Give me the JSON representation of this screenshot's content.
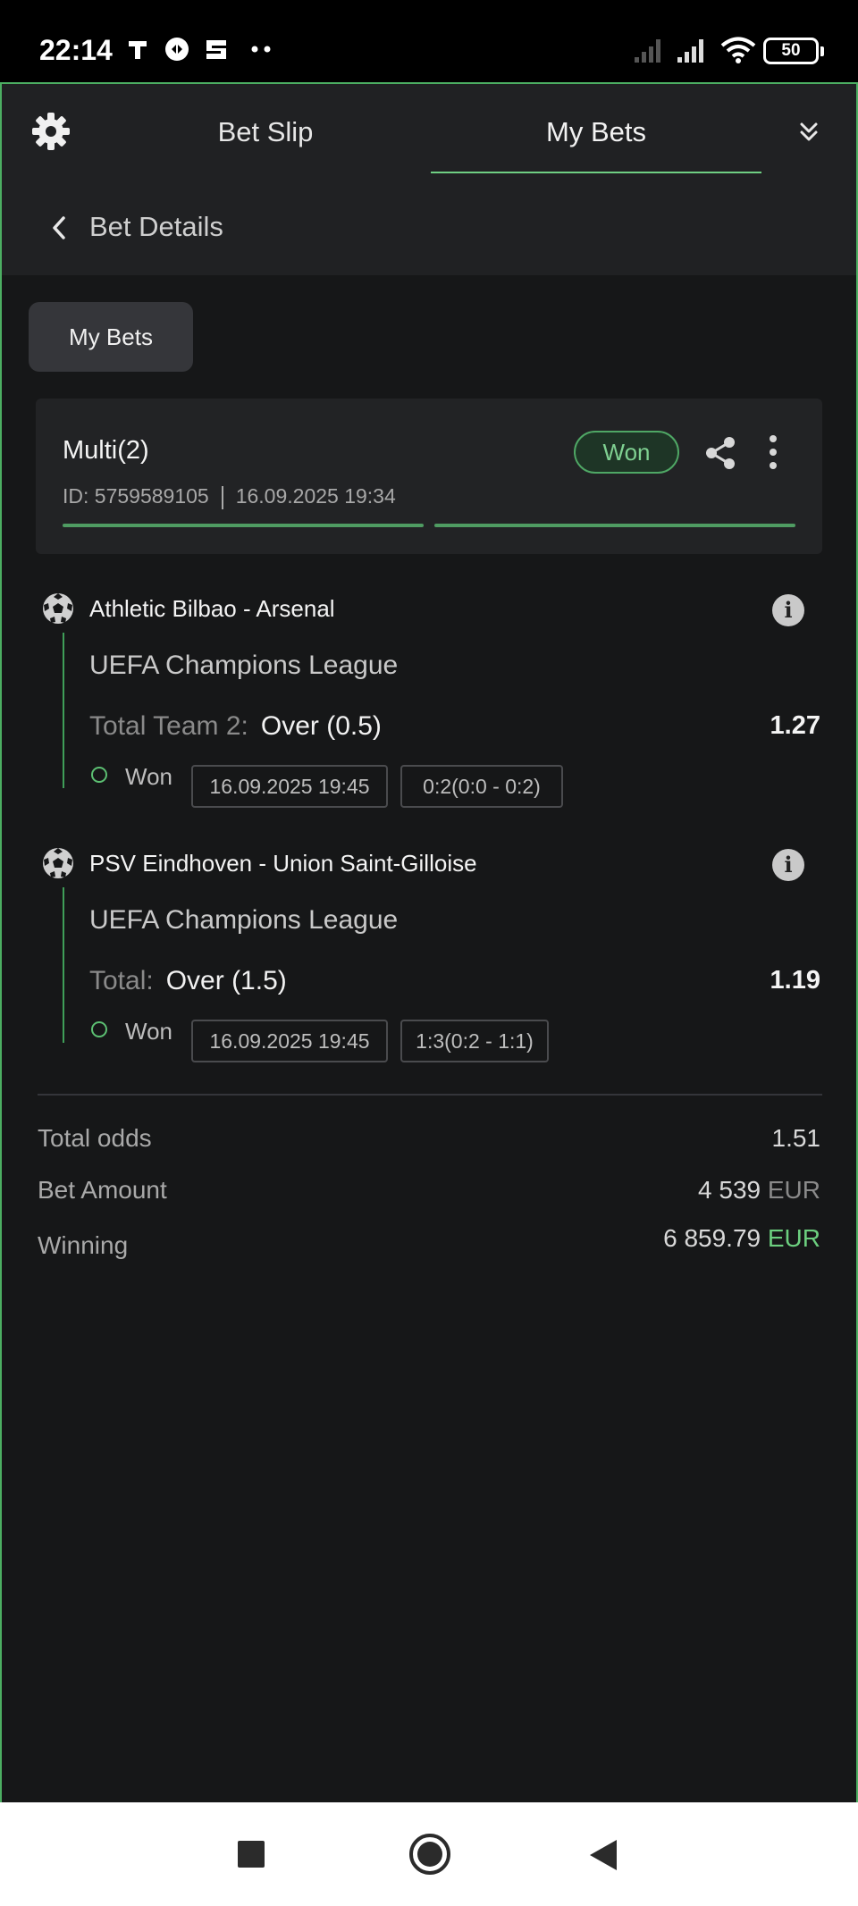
{
  "status_bar": {
    "time": "22:14",
    "battery": "50"
  },
  "tabs": {
    "bet_slip": "Bet Slip",
    "my_bets": "My Bets"
  },
  "header": {
    "title": "Bet Details"
  },
  "my_bets_button": "My Bets",
  "bet": {
    "title": "Multi(2)",
    "id_label": "ID: 5759589105",
    "placed_at": "16.09.2025 19:34",
    "status": "Won",
    "accent_color": "#4fa765"
  },
  "events": [
    {
      "teams": "Athletic Bilbao - Arsenal",
      "league": "UEFA Champions League",
      "market": "Total Team 2:",
      "selection": "Over (0.5)",
      "odds": "1.27",
      "status": "Won",
      "date": "16.09.2025 19:45",
      "score": "0:2(0:0 - 0:2)"
    },
    {
      "teams": "PSV Eindhoven - Union Saint-Gilloise",
      "league": "UEFA Champions League",
      "market": "Total:",
      "selection": "Over (1.5)",
      "odds": "1.19",
      "status": "Won",
      "date": "16.09.2025 19:45",
      "score": "1:3(0:2 - 1:1)"
    }
  ],
  "summary": {
    "total_odds_label": "Total odds",
    "total_odds_value": "1.51",
    "bet_amount_label": "Bet Amount",
    "bet_amount_value": "4 539",
    "bet_amount_currency": "EUR",
    "winning_label": "Winning",
    "winning_value": "6 859.79",
    "winning_currency": "EUR"
  },
  "icons": {
    "settings": "gear-icon",
    "collapse": "double-chevron-down-icon",
    "back": "chevron-left-icon",
    "share": "share-icon",
    "more": "kebab-menu-icon",
    "sport": "soccer-ball-icon",
    "info": "info-icon"
  }
}
